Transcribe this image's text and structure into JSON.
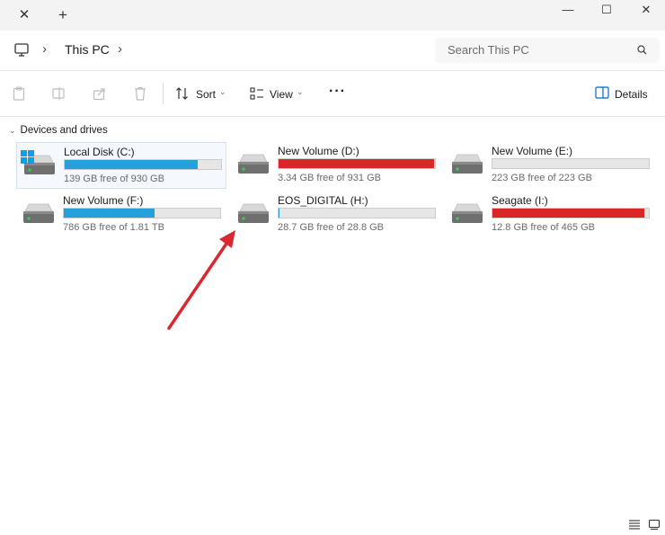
{
  "window": {
    "tab_close_glyph": "✕",
    "tab_add_glyph": "+",
    "minimize_glyph": "—",
    "maximize_glyph": "☐",
    "close_glyph": "✕"
  },
  "address": {
    "breadcrumb": "This PC",
    "chevron": "›",
    "search_placeholder": "Search This PC"
  },
  "toolbar": {
    "sort_label": "Sort",
    "view_label": "View",
    "more_label": "···",
    "details_label": "Details",
    "caret": "⌄"
  },
  "section": {
    "title": "Devices and drives",
    "caret": "⌄"
  },
  "drives": [
    {
      "name": "Local Disk (C:)",
      "free": "139 GB free of 930 GB",
      "used_fraction": 0.85,
      "bar_color": "#26a0da",
      "os": true
    },
    {
      "name": "New Volume (D:)",
      "free": "3.34 GB free of 931 GB",
      "used_fraction": 0.996,
      "bar_color": "#da2626",
      "os": false
    },
    {
      "name": "New Volume (E:)",
      "free": "223 GB free of 223 GB",
      "used_fraction": 0.0,
      "bar_color": "#26a0da",
      "os": false
    },
    {
      "name": "New Volume (F:)",
      "free": "786 GB free of 1.81 TB",
      "used_fraction": 0.58,
      "bar_color": "#26a0da",
      "os": false
    },
    {
      "name": "EOS_DIGITAL (H:)",
      "free": "28.7 GB free of 28.8 GB",
      "used_fraction": 0.004,
      "bar_color": "#26a0da",
      "os": false
    },
    {
      "name": "Seagate (I:)",
      "free": "12.8 GB free of 465 GB",
      "used_fraction": 0.97,
      "bar_color": "#da2626",
      "os": false
    }
  ],
  "annotation": {
    "arrow_color": "#d9282f"
  }
}
